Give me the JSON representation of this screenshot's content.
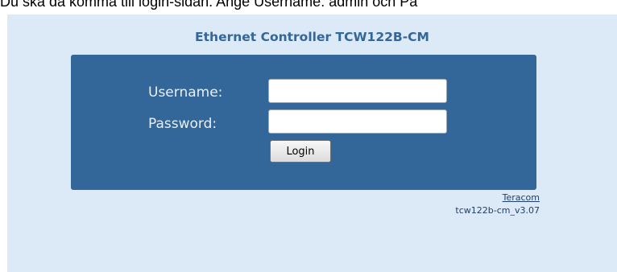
{
  "caption": {
    "text": "Du ska då komma till login-sidan. Ange Username: admin och Pa"
  },
  "page": {
    "title": "Ethernet Controller TCW122B-CM"
  },
  "login": {
    "username_label": "Username:",
    "password_label": "Password:",
    "username_value": "",
    "password_value": "",
    "button_label": "Login"
  },
  "footer": {
    "brand_link": "Teracom",
    "version": "tcw122b-cm_v3.07"
  },
  "colors": {
    "page_background": "#dce9f7",
    "panel_background": "#336699",
    "title_color": "#336699",
    "link_color": "#1f3f6e"
  }
}
